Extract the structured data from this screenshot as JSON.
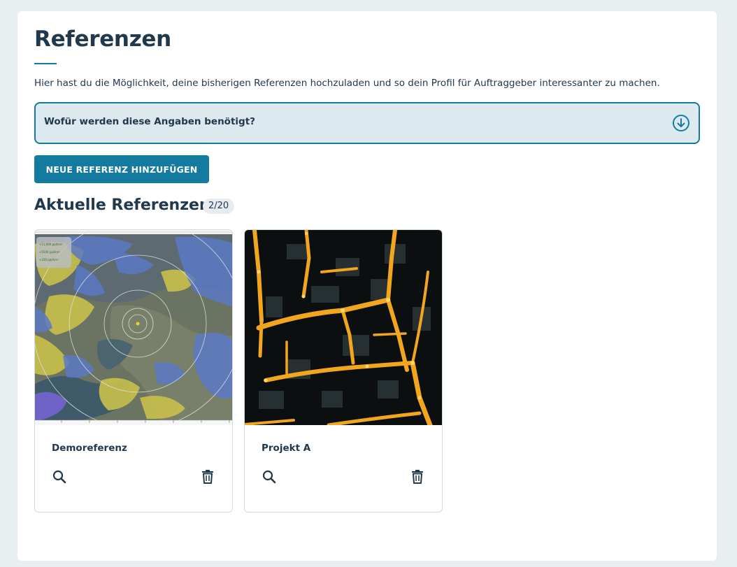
{
  "page": {
    "title": "Referenzen",
    "intro": "Hier hast du die Möglichkeit, deine bisherigen Referenzen hochzuladen und so dein Profil für Auftraggeber interessanter zu machen."
  },
  "faq": {
    "question": "Wofür werden diese Angaben benötigt?",
    "icon": "arrow-down-circle-icon",
    "expanded": false
  },
  "actions": {
    "add_reference_label": "NEUE REFERENZ HINZUFÜGEN"
  },
  "references": {
    "section_title": "Aktuelle Referenzen",
    "count": "2/20",
    "items": [
      {
        "name": "Demoreferenz",
        "image": "map-with-population-density-overlay",
        "map_legend": [
          "<11,000 ppl/km²",
          "<5500 ppl/km²",
          "<330 ppl/km²"
        ],
        "view_icon": "search-icon",
        "delete_icon": "trash-icon"
      },
      {
        "name": "Projekt A",
        "image": "aerial-night-street-lights",
        "view_icon": "search-icon",
        "delete_icon": "trash-icon"
      }
    ]
  },
  "colors": {
    "primary": "#137aa0",
    "text": "#22384d",
    "page_bg": "#e9eef1",
    "faq_bg": "#dce9ee"
  }
}
